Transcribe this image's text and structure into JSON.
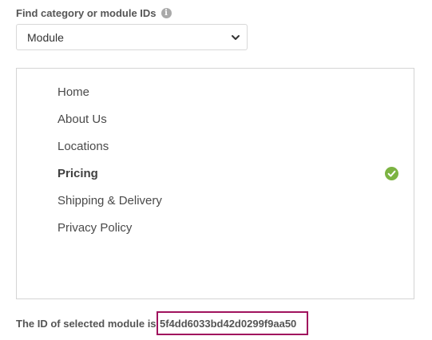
{
  "finder": {
    "label": "Find category or module IDs",
    "info_icon": "info-icon"
  },
  "select": {
    "value": "Module",
    "icon": "chevron-down-icon"
  },
  "menu": {
    "items": [
      {
        "label": "Home",
        "selected": false
      },
      {
        "label": "About Us",
        "selected": false
      },
      {
        "label": "Locations",
        "selected": false
      },
      {
        "label": "Pricing",
        "selected": true
      },
      {
        "label": "Shipping & Delivery",
        "selected": false
      },
      {
        "label": "Privacy Policy",
        "selected": false
      }
    ],
    "selected_icon": "check-circle-icon",
    "selected_color": "#7cb342"
  },
  "result": {
    "prefix": "The ID of selected module is",
    "id": "5f4dd6033bd42d0299f9aa50",
    "highlight_color": "#a0135e"
  }
}
